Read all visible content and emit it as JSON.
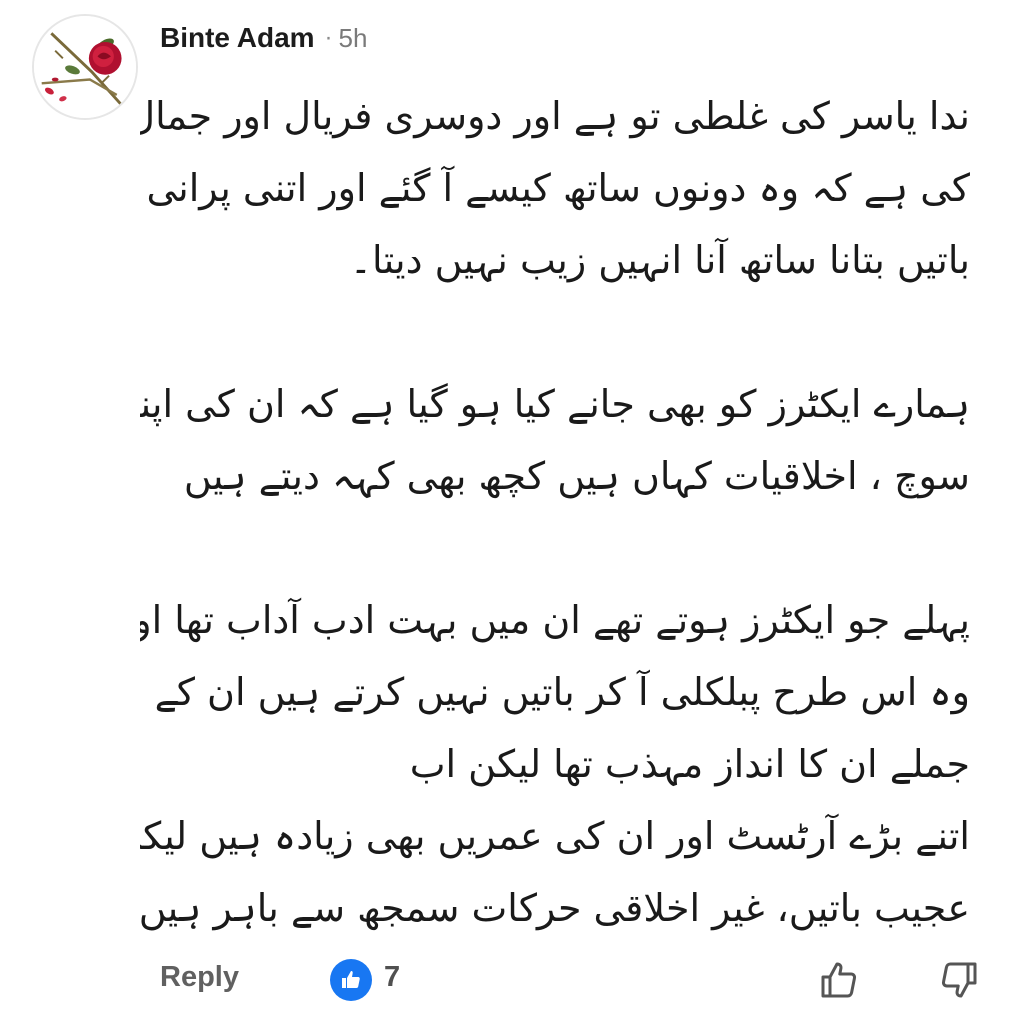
{
  "comment": {
    "author": "Binte Adam",
    "separator": "·",
    "time": "5h",
    "lines": [
      "ندا یاسر کی غلطی تو ہے اور دوسری فریال اور جمال",
      "کی ہے کہ وہ دونوں ساتھ کیسے آ گئے اور اتنی پرانی",
      "باتیں بتانا ساتھ آنا انہیں زیب نہیں دیتا۔",
      "",
      "ہمارے ایکٹرز کو بھی جانے کیا ہو گیا ہے کہ ان کی اپنی",
      "سوچ ، اخلاقیات کہاں ہیں کچھ بھی کہہ دیتے ہیں",
      "",
      "پہلے جو ایکٹرز ہوتے تھے ان میں بہت ادب آداب تھا اور",
      "وہ اس طرح پبلکلی آ کر باتیں نہیں کرتے ہیں ان کے",
      "جملے ان کا انداز مہذب تھا لیکن اب",
      "اتنے بڑے آرٹسٹ اور ان کی عمریں بھی زیادہ ہیں لیکن",
      "عجیب باتیں، غیر اخلاقی حرکات سمجھ سے باہر ہیں"
    ]
  },
  "footer": {
    "reply_label": "Reply",
    "like_count": "7",
    "like_icon": "thumbs-up-icon",
    "upvote_icon": "thumbs-up-outline-icon",
    "downvote_icon": "thumbs-down-outline-icon"
  },
  "colors": {
    "like_badge": "#1877f2",
    "author": "#1c1c1c",
    "meta": "#7a7a7a",
    "reply": "#606060"
  }
}
